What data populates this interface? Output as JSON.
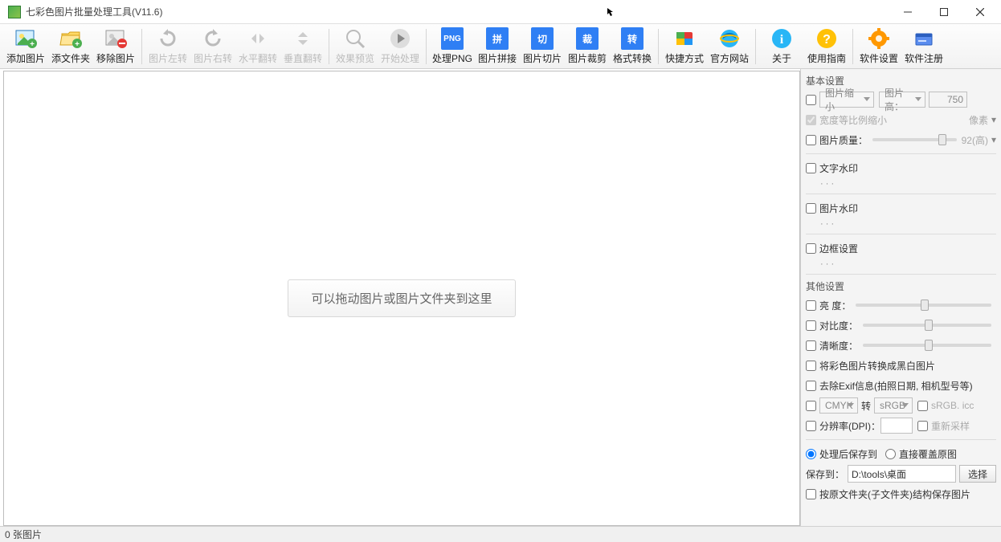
{
  "window": {
    "title": "七彩色图片批量处理工具(V11.6)"
  },
  "toolbar": {
    "add_image": "添加图片",
    "add_folder": "添文件夹",
    "remove_image": "移除图片",
    "rotate_left": "图片左转",
    "rotate_right": "图片右转",
    "flip_h": "水平翻转",
    "flip_v": "垂直翻转",
    "preview": "效果预览",
    "start": "开始处理",
    "png": "处理PNG",
    "png_tile": "PNG",
    "join": "图片拼接",
    "join_tile": "拼",
    "slice": "图片切片",
    "slice_tile": "切",
    "crop": "图片裁剪",
    "crop_tile": "裁",
    "convert": "格式转换",
    "convert_tile": "转",
    "shortcut": "快捷方式",
    "website": "官方网站",
    "about": "关于",
    "guide": "使用指南",
    "settings": "软件设置",
    "register": "软件注册"
  },
  "canvas": {
    "drop_hint": "可以拖动图片或图片文件夹到这里"
  },
  "side": {
    "basic_header": "基本设置",
    "shrink_label": "图片缩小",
    "height_label": "图片高：",
    "height_value": "750",
    "keep_ratio": "宽度等比例缩小",
    "unit_label": "像素",
    "quality_label": "图片质量：",
    "quality_value": "92(高)",
    "text_wm": "文字水印",
    "image_wm": "图片水印",
    "border": "边框设置",
    "dots": "·   ·   ·",
    "other_header": "其他设置",
    "brightness": "亮    度：",
    "contrast": "对比度：",
    "sharpness": "清晰度：",
    "to_bw": "将彩色图片转换成黑白图片",
    "remove_exif": "去除Exif信息(拍照日期, 相机型号等)",
    "cmyk": "CMYK",
    "to": "转",
    "srgb": "sRGB",
    "srgb_icc": "sRGB. icc",
    "dpi": "分辨率(DPI)：",
    "resample": "重新采样",
    "save_to_radio": "处理后保存到",
    "overwrite_radio": "直接覆盖原图",
    "save_to_label": "保存到：",
    "save_path": "D:\\tools\\桌面",
    "browse": "选择",
    "keep_tree": "按原文件夹(子文件夹)结构保存图片"
  },
  "status": {
    "count": "0 张图片"
  }
}
